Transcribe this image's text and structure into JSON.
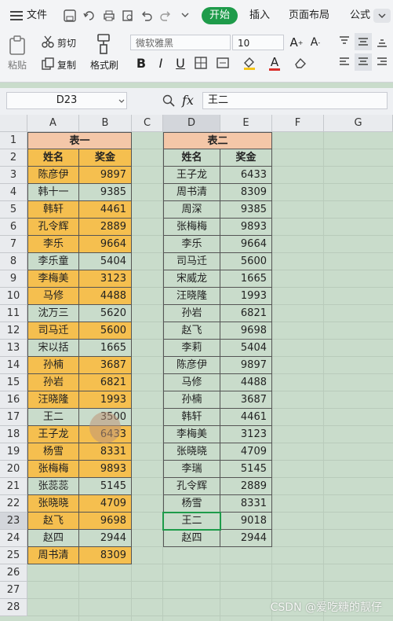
{
  "menu": {
    "file_label": "文件",
    "tabs": [
      "开始",
      "插入",
      "页面布局",
      "公式"
    ]
  },
  "ribbon": {
    "cut_label": "剪切",
    "paste_label": "粘贴",
    "copy_label": "复制",
    "format_painter_label": "格式刷",
    "font_name": "微软雅黑",
    "font_size": "10",
    "bold": "B",
    "italic": "I",
    "underline": "U",
    "font_color_letter": "A"
  },
  "formula_bar": {
    "name_box": "D23",
    "fx": "fx",
    "content": "王二"
  },
  "columns": [
    "A",
    "B",
    "C",
    "D",
    "E",
    "F",
    "G"
  ],
  "rows": [
    "1",
    "2",
    "3",
    "4",
    "5",
    "6",
    "7",
    "8",
    "9",
    "10",
    "11",
    "12",
    "13",
    "14",
    "15",
    "16",
    "17",
    "18",
    "19",
    "20",
    "21",
    "22",
    "23",
    "24",
    "25",
    "26",
    "27",
    "28"
  ],
  "table1": {
    "title": "表一",
    "headers": [
      "姓名",
      "奖金"
    ],
    "rows": [
      [
        "陈彦伊",
        "9897"
      ],
      [
        "韩十一",
        "9385"
      ],
      [
        "韩轩",
        "4461"
      ],
      [
        "孔令辉",
        "2889"
      ],
      [
        "李乐",
        "9664"
      ],
      [
        "李乐童",
        "5404"
      ],
      [
        "李梅美",
        "3123"
      ],
      [
        "马修",
        "4488"
      ],
      [
        "沈万三",
        "5620"
      ],
      [
        "司马迁",
        "5600"
      ],
      [
        "宋以括",
        "1665"
      ],
      [
        "孙楠",
        "3687"
      ],
      [
        "孙岩",
        "6821"
      ],
      [
        "汪晓隆",
        "1993"
      ],
      [
        "王二",
        "3500"
      ],
      [
        "王子龙",
        "6433"
      ],
      [
        "杨雪",
        "8331"
      ],
      [
        "张梅梅",
        "9893"
      ],
      [
        "张蕊蕊",
        "5145"
      ],
      [
        "张晓晓",
        "4709"
      ],
      [
        "赵飞",
        "9698"
      ],
      [
        "赵四",
        "2944"
      ],
      [
        "周书清",
        "8309"
      ]
    ],
    "highlighted_rows": [
      0,
      2,
      3,
      4,
      6,
      7,
      9,
      11,
      12,
      13,
      15,
      16,
      17,
      19,
      20,
      22
    ]
  },
  "table2": {
    "title": "表二",
    "headers": [
      "姓名",
      "奖金"
    ],
    "rows": [
      [
        "王子龙",
        "6433"
      ],
      [
        "周书清",
        "8309"
      ],
      [
        "周深",
        "9385"
      ],
      [
        "张梅梅",
        "9893"
      ],
      [
        "李乐",
        "9664"
      ],
      [
        "司马迁",
        "5600"
      ],
      [
        "宋威龙",
        "1665"
      ],
      [
        "汪晓隆",
        "1993"
      ],
      [
        "孙岩",
        "6821"
      ],
      [
        "赵飞",
        "9698"
      ],
      [
        "李莉",
        "5404"
      ],
      [
        "陈彦伊",
        "9897"
      ],
      [
        "马修",
        "4488"
      ],
      [
        "孙楠",
        "3687"
      ],
      [
        "韩轩",
        "4461"
      ],
      [
        "李梅美",
        "3123"
      ],
      [
        "张晓晓",
        "4709"
      ],
      [
        "李瑞",
        "5145"
      ],
      [
        "孔令辉",
        "2889"
      ],
      [
        "杨雪",
        "8331"
      ],
      [
        "王二",
        "9018"
      ],
      [
        "赵四",
        "2944"
      ]
    ]
  },
  "colors": {
    "highlight": "#f5bf4f",
    "title_fill": "#f4c7a8",
    "header_fill": "#f5bf4f",
    "plain_fill": "#c9dccb",
    "accent_green": "#1e9b4a"
  },
  "watermark": "CSDN @爱吃糖的靓仔"
}
